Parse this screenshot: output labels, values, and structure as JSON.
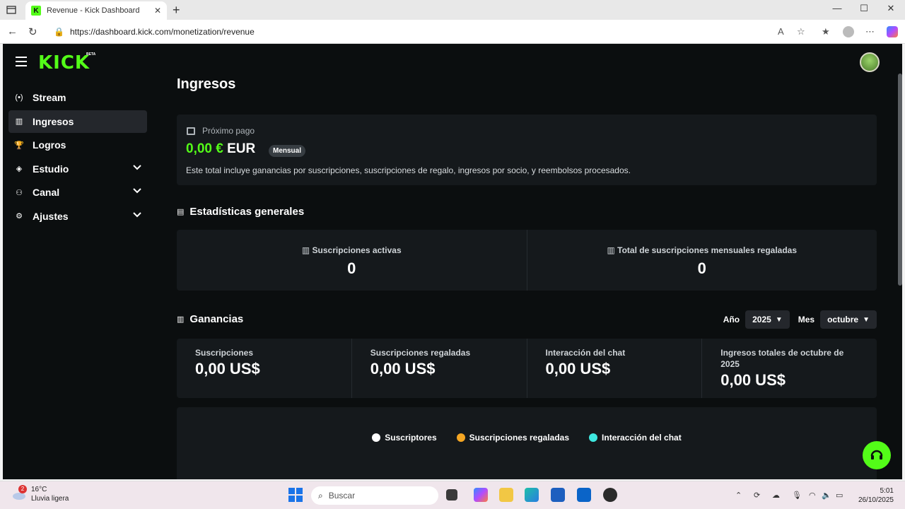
{
  "browser": {
    "tab_title": "Revenue - Kick Dashboard",
    "url": "https://dashboard.kick.com/monetization/revenue"
  },
  "app": {
    "logo": "KICK",
    "beta": "BETA"
  },
  "sidebar": {
    "items": [
      {
        "label": "Stream",
        "icon": "stream-icon"
      },
      {
        "label": "Ingresos",
        "icon": "chart-icon",
        "active": true
      },
      {
        "label": "Logros",
        "icon": "trophy-icon"
      },
      {
        "label": "Estudio",
        "icon": "studio-icon",
        "expandable": true
      },
      {
        "label": "Canal",
        "icon": "channel-icon",
        "expandable": true
      },
      {
        "label": "Ajustes",
        "icon": "gear-icon",
        "expandable": true
      }
    ]
  },
  "page": {
    "title": "Ingresos",
    "payout": {
      "label": "Próximo pago",
      "amount": "0,00 €",
      "currency": "EUR",
      "badge": "Mensual",
      "description": "Este total incluye ganancias por suscripciones, suscripciones de regalo, ingresos por socio, y reembolsos procesados."
    },
    "stats": {
      "title": "Estadísticas generales",
      "items": [
        {
          "label": "Suscripciones activas",
          "value": "0"
        },
        {
          "label": "Total de suscripciones mensuales regaladas",
          "value": "0"
        }
      ]
    },
    "earnings": {
      "title": "Ganancias",
      "year_label": "Año",
      "year_value": "2025",
      "month_label": "Mes",
      "month_value": "octubre",
      "cells": [
        {
          "label": "Suscripciones",
          "value": "0,00 US$"
        },
        {
          "label": "Suscripciones regaladas",
          "value": "0,00 US$"
        },
        {
          "label": "Interacción del chat",
          "value": "0,00 US$"
        },
        {
          "label": "Ingresos totales de octubre de 2025",
          "value": "0,00 US$"
        }
      ]
    },
    "legend": [
      {
        "label": "Suscriptores",
        "color": "#ffffff"
      },
      {
        "label": "Suscripciones regaladas",
        "color": "#f5a623"
      },
      {
        "label": "Interacción del chat",
        "color": "#3ee8e0"
      }
    ]
  },
  "taskbar": {
    "weather_temp": "16°C",
    "weather_desc": "Lluvia ligera",
    "weather_badge": "2",
    "search_placeholder": "Buscar",
    "time": "5:01",
    "date": "26/10/2025"
  },
  "colors": {
    "accent": "#53fc18",
    "background": "#0b0e0f",
    "card": "#15191c"
  }
}
